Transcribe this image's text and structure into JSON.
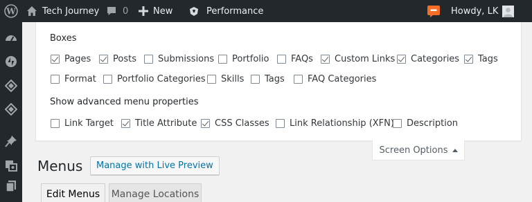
{
  "admin_bar": {
    "site_name": "Tech Journey",
    "comments_count": "0",
    "new_label": "New",
    "performance_label": "Performance",
    "howdy": "Howdy, LK"
  },
  "sidebar": {
    "icons": [
      "dashboard-icon",
      "jetpack-icon",
      "layers-icon",
      "layers-icon",
      "pin-icon",
      "media-icon",
      "pages-icon"
    ]
  },
  "screen_options": {
    "boxes_heading": "Boxes",
    "boxes": [
      {
        "label": "Pages",
        "checked": true
      },
      {
        "label": "Posts",
        "checked": true
      },
      {
        "label": "Submissions",
        "checked": false
      },
      {
        "label": "Portfolio",
        "checked": false
      },
      {
        "label": "FAQs",
        "checked": false
      },
      {
        "label": "Custom Links",
        "checked": true
      },
      {
        "label": "Categories",
        "checked": true
      },
      {
        "label": "Tags",
        "checked": true
      },
      {
        "label": "Format",
        "checked": false
      },
      {
        "label": "Portfolio Categories",
        "checked": false
      },
      {
        "label": "Skills",
        "checked": false
      },
      {
        "label": "Tags",
        "checked": false
      },
      {
        "label": "FAQ Categories",
        "checked": false
      }
    ],
    "advanced_heading": "Show advanced menu properties",
    "advanced": [
      {
        "label": "Link Target",
        "checked": false
      },
      {
        "label": "Title Attribute",
        "checked": true
      },
      {
        "label": "CSS Classes",
        "checked": true
      },
      {
        "label": "Link Relationship (XFN)",
        "checked": false
      },
      {
        "label": "Description",
        "checked": false
      }
    ],
    "toggle_label": "Screen Options"
  },
  "page": {
    "title": "Menus",
    "live_preview_label": "Manage with Live Preview",
    "tabs": [
      {
        "label": "Edit Menus",
        "active": true
      },
      {
        "label": "Manage Locations",
        "active": false
      }
    ]
  },
  "colors": {
    "admin_bar_bg": "#23282d",
    "accent_link": "#0073aa",
    "notification": "#f56e28"
  }
}
